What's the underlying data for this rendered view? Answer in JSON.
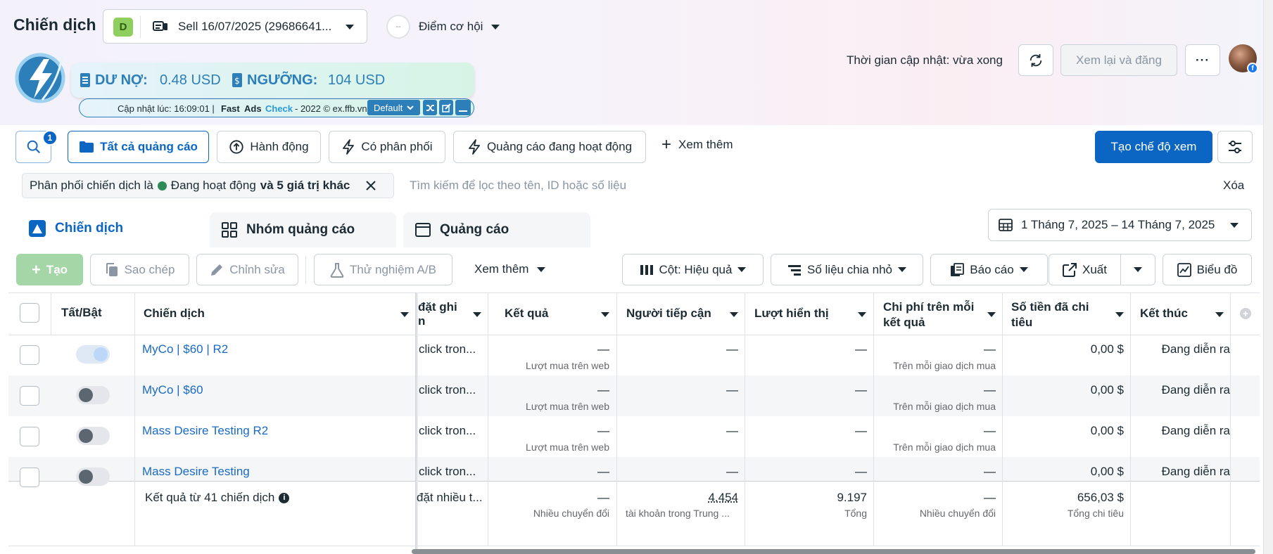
{
  "header": {
    "title": "Chiến dịch",
    "account_badge": "D",
    "account_name": "Sell 16/07/2025 (29686641...",
    "opportunity_icon_text": "--",
    "opportunity_label": "Điểm cơ hội",
    "update_time": "Thời gian cập nhật: vừa xong",
    "review_publish": "Xem lại và đăng",
    "more": "···"
  },
  "adscheck": {
    "debt_label": "DƯ NỢ:",
    "debt_value": "0.48 USD",
    "threshold_label": "NGƯỠNG:",
    "threshold_value": "104 USD",
    "updated_prefix": "Cập nhật lúc: 16:09:01 |",
    "brand_fast": "Fast",
    "brand_ads": "Ads",
    "brand_check": "Check",
    "credit": "- 2022 © ex.ffb.vn",
    "mode": "Default"
  },
  "toolbar": {
    "search_badge": "1",
    "all_ads": "Tất cả quảng cáo",
    "actions": "Hành động",
    "delivering": "Có phân phối",
    "active_ads": "Quảng cáo đang hoạt động",
    "see_more": "Xem thêm",
    "create_view": "Tạo chế độ xem"
  },
  "filter": {
    "chip_prefix": "Phân phối chiến dịch là",
    "chip_status": "Đang hoạt động",
    "chip_suffix": "và 5 giá trị khác",
    "placeholder": "Tìm kiếm để lọc theo tên, ID hoặc số liệu",
    "clear": "Xóa"
  },
  "tabs": [
    {
      "label": "Chiến dịch",
      "active": true
    },
    {
      "label": "Nhóm quảng cáo",
      "active": false
    },
    {
      "label": "Quảng cáo",
      "active": false
    }
  ],
  "date_range": "1 Tháng 7, 2025 – 14 Tháng 7, 2025",
  "actionbar": {
    "create": "Tạo",
    "duplicate": "Sao chép",
    "edit": "Chỉnh sửa",
    "ab_test": "Thử nghiệm A/B",
    "see_more": "Xem thêm",
    "columns": "Cột: Hiệu quả",
    "breakdown": "Số liệu chia nhỏ",
    "reports": "Báo cáo",
    "export": "Xuất",
    "chart": "Biểu đồ"
  },
  "table": {
    "headers": {
      "toggle": "Tất/Bật",
      "campaign": "Chiến dịch",
      "attribution_line1": "đặt ghi",
      "attribution_line2": "n",
      "results": "Kết quả",
      "reach": "Người tiếp cận",
      "impressions": "Lượt hiển thị",
      "cpr_line1": "Chi phí trên mỗi",
      "cpr_line2": "kết quả",
      "spent_line1": "Số tiền đã chi",
      "spent_line2": "tiêu",
      "ends": "Kết thúc"
    },
    "rows": [
      {
        "name": "MyCo | $60 | R2",
        "on": true,
        "attribution": "click tron...",
        "results": "—",
        "results_sub": "Lượt mua trên web",
        "reach": "—",
        "impressions": "—",
        "cpr": "—",
        "cpr_sub": "Trên mỗi giao dịch mua",
        "spent": "0,00 $",
        "ends": "Đang diễn ra"
      },
      {
        "name": "MyCo | $60",
        "on": false,
        "attribution": "click tron...",
        "results": "—",
        "results_sub": "Lượt mua trên web",
        "reach": "—",
        "impressions": "—",
        "cpr": "—",
        "cpr_sub": "Trên mỗi giao dịch mua",
        "spent": "0,00 $",
        "ends": "Đang diễn ra"
      },
      {
        "name": "Mass Desire Testing R2",
        "on": false,
        "attribution": "click tron...",
        "results": "—",
        "results_sub": "Lượt mua trên web",
        "reach": "—",
        "impressions": "—",
        "cpr": "—",
        "cpr_sub": "Trên mỗi giao dịch mua",
        "spent": "0,00 $",
        "ends": "Đang diễn ra"
      },
      {
        "name": "Mass Desire Testing",
        "on": false,
        "attribution": "click tron...",
        "results": "—",
        "results_sub": "",
        "reach": "—",
        "impressions": "—",
        "cpr": "—",
        "cpr_sub": "",
        "spent": "0,00 $",
        "ends": "Đang diễn ra"
      }
    ],
    "summary": {
      "label": "Kết quả từ 41 chiến dịch",
      "attribution": "đặt nhiều t...",
      "results": "—",
      "results_sub": "Nhiều chuyển đổi",
      "reach": "4.454",
      "reach_sub": "tài khoản trong Trung ...",
      "impressions": "9.197",
      "impressions_sub": "Tổng",
      "cpr": "—",
      "cpr_sub": "Nhiều chuyển đổi",
      "spent": "656,03 $",
      "spent_sub": "Tổng chi tiêu"
    }
  },
  "colors": {
    "primary": "#0a66c2",
    "link": "#1a6ac4",
    "status_green": "#2e8b57",
    "adscheck_blue": "#2c7fb8"
  }
}
